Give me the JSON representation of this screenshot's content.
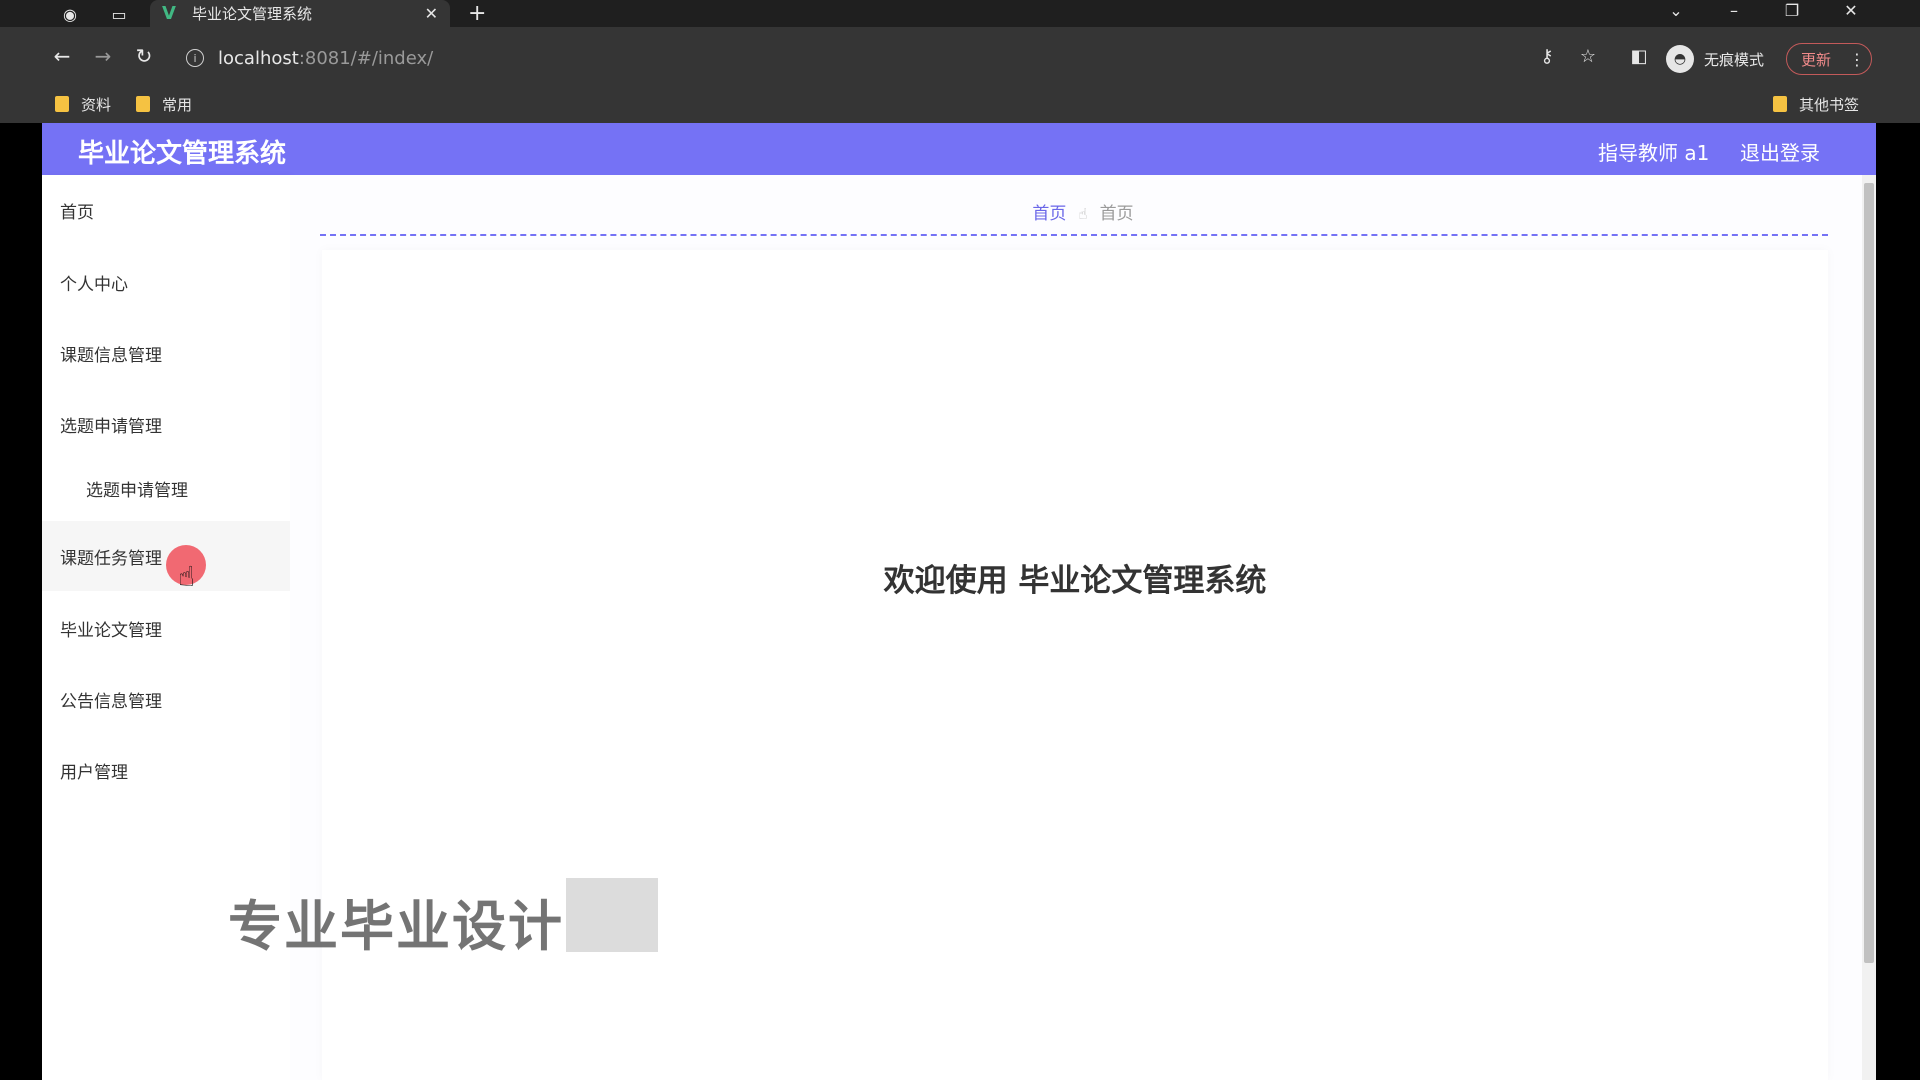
{
  "browser": {
    "tab_title": "毕业论文管理系统",
    "tab_close": "✕",
    "new_tab": "+",
    "url_host": "localhost",
    "url_rest": ":8081/#/index/",
    "incognito_label": "无痕模式",
    "update_label": "更新",
    "bookmarks": [
      "资料",
      "常用"
    ],
    "other_bookmarks": "其他书签",
    "icons": [
      "globe-icon",
      "tab-search-icon",
      "back-icon",
      "forward-icon",
      "reload-icon",
      "info-icon",
      "key-icon",
      "star-icon",
      "side-panel-icon",
      "incognito-icon",
      "menu-dots-icon",
      "minimize-icon",
      "restore-icon",
      "close-icon"
    ]
  },
  "app": {
    "title": "毕业论文管理系统",
    "user": "指导教师 a1",
    "logout": "退出登录",
    "accent_color": "#7572f5"
  },
  "sidebar": {
    "items": [
      {
        "label": "首页"
      },
      {
        "label": "个人中心"
      },
      {
        "label": "课题信息管理"
      },
      {
        "label": "选题申请管理"
      },
      {
        "label": "选题申请管理"
      },
      {
        "label": "课题任务管理"
      },
      {
        "label": "毕业论文管理"
      },
      {
        "label": "公告信息管理"
      },
      {
        "label": "用户管理"
      }
    ]
  },
  "breadcrumb": {
    "home": "首页",
    "current": "首页"
  },
  "main": {
    "welcome": "欢迎使用 毕业论文管理系统"
  },
  "overlay": {
    "watermark": "专业毕业设计"
  }
}
